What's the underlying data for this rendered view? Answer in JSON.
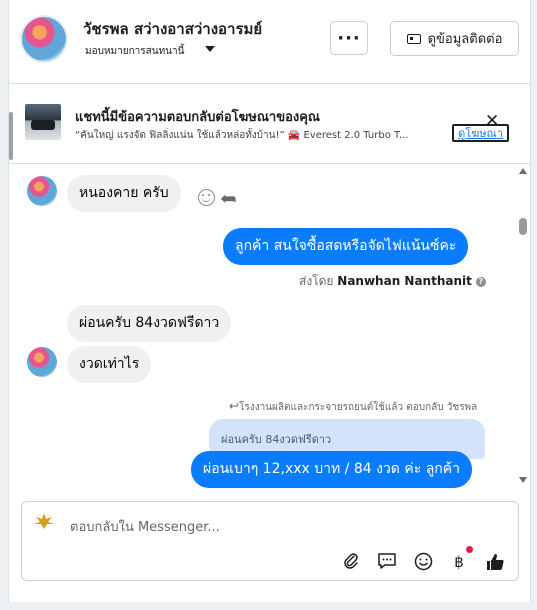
{
  "header": {
    "name": "วัชรพล สว่างอาสว่างอารมย์",
    "assign_label": "มอบหมายการสนทนานี้",
    "more_label": "···",
    "contact_label": "ดูข้อมูลติดต่อ"
  },
  "ad": {
    "title": "แชทนี้มีข้อความตอบกลับต่อโฆษณาของคุณ",
    "text": "“คันใหญ่ แรงจัด ฟิลลิ่งแน่น ใช้แล้วหล่อทั้งบ้าน!” 🚘 Everest 2.0 Turbo T...",
    "link_label": "ดูโฆษณา",
    "close_label": "✕"
  },
  "messages": {
    "m1": "หนองคาย ครับ",
    "m2": "ลูกค้า สนใจซื้อสดหรือจัดไฟแน้นซ์คะ",
    "sent_by_prefix": "ส่งโดย",
    "sent_by_name": "Nanwhan Nanthanit",
    "info": "?",
    "m3": "ผ่อนครับ 84งวดฟรีดาว",
    "m4": "งวดเท่าไร",
    "reply_meta": "โรงงานผลิตและกระจายรถยนต์ใช้แล้ว ตอบกลับ วัชรพล",
    "reply_quote": "ผ่อนครับ 84งวดฟรีดาว",
    "m5": "ผ่อนเบาๆ 12,xxx บาท / 84 งวด ค่ะ  ลูกค้า"
  },
  "composer": {
    "placeholder": "ตอบกลับใน Messenger...",
    "icons": [
      "paperclip-icon",
      "chat-bubble-icon",
      "emoji-icon",
      "baht-icon",
      "thumbs-up-icon"
    ],
    "baht_symbol": "฿"
  },
  "colors": {
    "outgoing_bubble": "#0a7cff",
    "incoming_bubble": "#f0f0f0",
    "reply_quote_bg": "#d4e3fc",
    "link": "#1877f2"
  }
}
